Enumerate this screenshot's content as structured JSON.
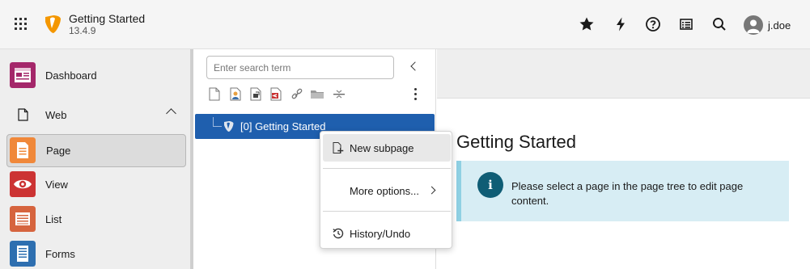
{
  "topbar": {
    "title": "Getting Started",
    "version": "13.4.9",
    "icons": [
      "app-grid-icon",
      "typo3-logo-icon",
      "star-icon",
      "lightning-icon",
      "help-icon",
      "list-icon",
      "search-icon",
      "user-avatar-icon"
    ],
    "user": "j.doe"
  },
  "modules": {
    "dashboard": {
      "label": "Dashboard",
      "color": "#a4276a"
    },
    "web_group": {
      "label": "Web",
      "expanded": true
    },
    "page": {
      "label": "Page",
      "color": "#f0883a",
      "active": true
    },
    "view": {
      "label": "View",
      "color": "#cc3333"
    },
    "list": {
      "label": "List",
      "color": "#d6643e"
    },
    "forms": {
      "label": "Forms",
      "color": "#2e6fb0"
    }
  },
  "tree": {
    "search_placeholder": "Enter search term",
    "toolbar_icons": [
      "new-page-icon",
      "new-page-with-user-icon",
      "link-to-external-url-icon",
      "shortcut-icon",
      "link-icon",
      "folder-icon",
      "separator-icon"
    ],
    "node_label": "[0] Getting Started",
    "selection_color": "#1f5fae"
  },
  "context_menu": {
    "items": [
      {
        "label": "New subpage",
        "icon": "new-subpage-icon",
        "hover": true
      },
      {
        "label": "More options...",
        "icon": "",
        "submenu": true
      },
      {
        "label": "History/Undo",
        "icon": "history-icon"
      }
    ]
  },
  "content": {
    "title": "Getting Started",
    "info_message": "Please select a page in the page tree to edit page content.",
    "info_color": "#d7edf4"
  }
}
